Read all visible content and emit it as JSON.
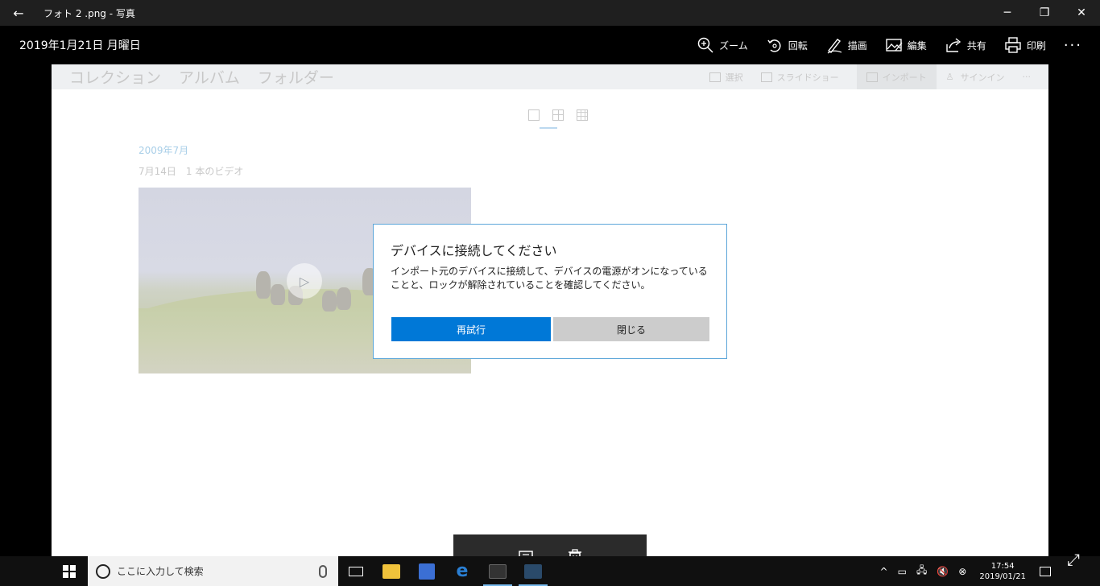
{
  "window": {
    "title": "フォト 2 .png - 写真",
    "back": "←",
    "minimize": "─",
    "restore": "❐",
    "close": "✕"
  },
  "viewer": {
    "date": "2019年1月21日 月曜日",
    "tools": {
      "zoom": "ズーム",
      "rotate": "回転",
      "draw": "描画",
      "edit": "編集",
      "share": "共有",
      "print": "印刷",
      "more": "···"
    }
  },
  "app": {
    "tabs": [
      "コレクション",
      "アルバム",
      "フォルダー"
    ],
    "actions": {
      "select": "選択",
      "slideshow": "スライドショー",
      "import": "インポート",
      "signin": "サインイン",
      "more": "···"
    },
    "month": "2009年7月",
    "dayinfo": "7月14日　1 本のビデオ",
    "play": "▷"
  },
  "dialog": {
    "title": "デバイスに接続してください",
    "message": "インポート元のデバイスに接続して、デバイスの電源がオンになっていることと、ロックが解除されていることを確認してください。",
    "retry": "再試行",
    "close": "閉じる"
  },
  "strip": {
    "prev": "←",
    "next": "→"
  },
  "taskbar": {
    "search_placeholder": "ここに入力して検索",
    "time": "17:54",
    "date": "2019/01/21",
    "tray_up": "^",
    "expand": "⤢"
  }
}
